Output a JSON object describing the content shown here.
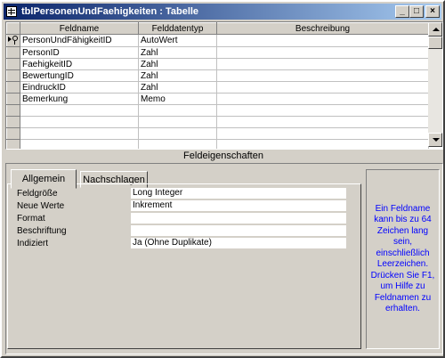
{
  "window": {
    "title": "tblPersonenUndFaehigkeiten : Tabelle",
    "app_icon": "table-icon",
    "controls": {
      "minimize": "_",
      "maximize": "□",
      "close": "×"
    },
    "active_title_color": "#0a246a",
    "gradient_end_color": "#a6caf0"
  },
  "grid": {
    "headers": {
      "field_name": "Feldname",
      "data_type": "Felddatentyp",
      "description": "Beschreibung"
    },
    "rows": [
      {
        "field_name": "PersonUndFähigkeitID",
        "data_type": "AutoWert",
        "description": "",
        "primary_key": true
      },
      {
        "field_name": "PersonID",
        "data_type": "Zahl",
        "description": ""
      },
      {
        "field_name": "FaehigkeitID",
        "data_type": "Zahl",
        "description": ""
      },
      {
        "field_name": "BewertungID",
        "data_type": "Zahl",
        "description": ""
      },
      {
        "field_name": "EindruckID",
        "data_type": "Zahl",
        "description": ""
      },
      {
        "field_name": "Bemerkung",
        "data_type": "Memo",
        "description": ""
      }
    ],
    "empty_rows": 5
  },
  "properties": {
    "section_title": "Feldeigenschaften",
    "tabs": [
      {
        "label": "Allgemein",
        "active": true
      },
      {
        "label": "Nachschlagen",
        "active": false
      }
    ],
    "rows": [
      {
        "label": "Feldgröße",
        "value": "Long Integer"
      },
      {
        "label": "Neue Werte",
        "value": "Inkrement"
      },
      {
        "label": "Format",
        "value": ""
      },
      {
        "label": "Beschriftung",
        "value": ""
      },
      {
        "label": "Indiziert",
        "value": "Ja (Ohne Duplikate)"
      }
    ],
    "help_text": "Ein Feldname kann bis zu 64 Zeichen lang sein, einschließlich Leerzeichen. Drücken Sie F1, um Hilfe zu Feldnamen zu erhalten.",
    "help_color": "#0000ff"
  }
}
